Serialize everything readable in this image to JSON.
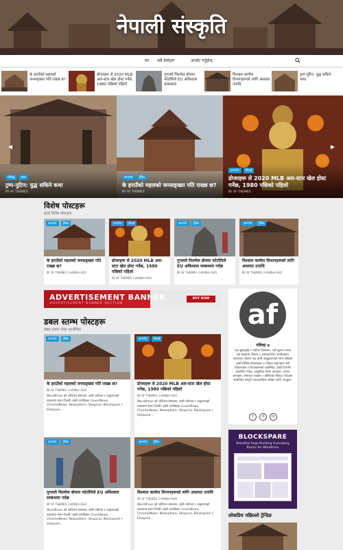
{
  "site": {
    "title": "नेपाली संस्कृति"
  },
  "nav": {
    "items": [
      "घर",
      "सबै डेमोहरू",
      "अपडेट गर्नुहोस्"
    ]
  },
  "colors": {
    "tag": "#1d9bd7",
    "ad_red": "#b5121b",
    "blockspare": "#3a1d56"
  },
  "ticker": [
    {
      "title": "के हराउँको महलको जनसङ्ख्या गति राख्छ छ?"
    },
    {
      "title": "डोजरहरू ले 2020 MLB अल-स्टार खेल होस्ट गर्नेछ, 1980 पछिको पहिलो"
    },
    {
      "title": "गुगलले फिल्मेल बोयमा फोटोमिले EU अविश्वास सम्बन्धमा"
    },
    {
      "title": "विश्वास कार्यमा विभागहरूको लागि असायत उपाधि"
    },
    {
      "title": "ट्रम्प-पुटिन: युद्ध सकिने कथा"
    }
  ],
  "slider": [
    {
      "tags": [
        "प्रसिद्ध",
        "यात्रा"
      ],
      "title": "ट्रम्प-पुटिन: युद्ध सकिने कथा",
      "meta": "BY AF THEMES"
    },
    {
      "tags": [
        "अन्तर्गत",
        "ट्रेंडिङ"
      ],
      "title": "के हराउँको महलको जनसङ्ख्या गति राख्छ छ?",
      "meta": "BY AF THEMES"
    },
    {
      "tags": [
        "अन्तर्गत",
        "फीचर्ड"
      ],
      "title": "डोजरहरू ले 2020 MLB अल-स्टार खेल होस्ट गर्नेछ, 1980 पछिको पहिलो",
      "meta": "BY AF THEMES"
    }
  ],
  "special": {
    "title": "विशेष पोस्टहरू",
    "subtitle": "हाम्रो विशेष पोस्टहरू",
    "posts": [
      {
        "tags": [
          "अन्तर्गत",
          "ट्रेंडिङ"
        ],
        "title": "के हराउँको महलको जनसङ्ख्या गति राख्छ छ?",
        "meta": "BY AF THEMES  3 वर्षपहिला AGO"
      },
      {
        "tags": [
          "अन्तर्गत",
          "फीचर्ड"
        ],
        "title": "डोजरहरू ले 2020 MLB अल-स्टार खेल होस्ट गर्नेछ, 1980 पछिको पहिलो",
        "meta": "BY AF THEMES  3 वर्षपहिला AGO"
      },
      {
        "tags": [
          "अन्तर्गत",
          "ट्रेंडिङ"
        ],
        "title": "गुगलले फिल्मेल बोयमा फोटोमिले EU अविश्वास सम्बन्धमा गर्दछ",
        "meta": "BY AF THEMES  3 वर्षपहिला AGO"
      },
      {
        "tags": [
          "अन्तर्गत",
          "ट्रेंडिङ"
        ],
        "title": "विश्वास कार्यमा विभागहरूको लागि असायत उपाधि",
        "meta": "BY AF THEMES  3 वर्षपहिला AGO"
      }
    ]
  },
  "ad": {
    "title": "ADVERTISEMENT BANNER",
    "subtitle": "ADVERTISEMENT BANNER SECTION",
    "button": "BUY NOW"
  },
  "double": {
    "title": "डबल स्तम्भ पोस्टहरू",
    "subtitle": "डबल स्तम्भ पोस्ट उपशीर्षक",
    "posts": [
      {
        "tags": [
          "अन्तर्गत",
          "ट्रेंडिङ"
        ],
        "title": "के हराउँको महलको जनसङ्ख्या गति राख्छ छ?",
        "meta": "BY AF THEMES  3 वर्षपहिला AGO",
        "excerpt": "WordPress को प्लेटिनम संसारमा, हामी नवीनता र उत्कृष्टताको प्रकाशमा स्थान दिन्छौ। हाम्रो उपाधिहरू CoverNews, ChromeNews, Newsphere, Shopical, Blockspare र Elespare..."
      },
      {
        "tags": [
          "अन्तर्गत",
          "फीचर्ड"
        ],
        "title": "डोजरहरू ले 2020 MLB अल-स्टार खेल होस्ट गर्नेछ, 1980 पछिको पहिलो",
        "meta": "BY AF THEMES  3 वर्षपहिला AGO",
        "excerpt": "WordPress को प्लेटिनम संसारमा, हामी नवीनता र उत्कृष्टताको प्रकाशमा स्थान दिन्छौ। हाम्रो उपाधिहरू CoverNews, ChromeNews, Newsphere, Shopical, Blockspare र Elespare..."
      },
      {
        "tags": [
          "अन्तर्गत",
          "ट्रेंडिङ"
        ],
        "title": "गुगलले फिल्मेल बोयमा फोटोमिले EU अविश्वास सम्बन्धमा गर्दछ",
        "meta": "BY AF THEMES  3 वर्षपहिला AGO",
        "excerpt": "WordPress को प्लेटिनम संसारमा, हामी नवीनता र उत्कृष्टताको प्रकाशमा स्थान दिन्छौ। हाम्रो उपाधिहरू CoverNews, ChromeNews, Newsphere, Shopical, Blockspare र Elespare..."
      },
      {
        "tags": [
          "अन्तर्गत",
          "ट्रेंडिङ"
        ],
        "title": "विश्वास कार्यमा विभागहरूको लागि असायत उपाधि",
        "meta": "BY AF THEMES  3 वर्षपहिला AGO",
        "excerpt": "WordPress को प्लेटिनम संसारमा, हामी नवीनता र उत्कृष्टताको प्रकाशमा स्थान दिन्छौ। हाम्रो उपाधिहरू CoverNews, ChromeNews, Newsphere, Shopical, Blockspare र Elespare..."
      }
    ]
  },
  "profile": {
    "logo": "af",
    "name": "पत्रिका ७",
    "desc": "एक सुसाइडेड र नयाँपन विषयमा, नयाँ सुरुमा रुपमा यस बखतमा पोस्टरू र समयकल्पित अपडेटहरू। समयावर प्लेटमा एक हामी अनुकूलताको साथ पछिको हामी विभिन्न सेक्शनहरू र पत्रिका कहानहरू सबै विकल्पहरू र विचारहरूको व्यवस्थित, हाम्रो टिप्पणि प्रकाशित गर्दछ। आधुनिक फेसन ब्लगहरू, ट्राभल ब्लगहरू, समाचार पत्रहरू र कोरिएका विस्तृत प्लेटहरू सम्बन्धित सम्पूर्ण जानकारीहरू सबैका लागि उपयुक्त।",
    "social": [
      "f",
      "X",
      "in"
    ]
  },
  "blockspare": {
    "name": "BLOCKSPARE",
    "tagline": "Beautiful Page Building Gutenberg Blocks for WordPress"
  },
  "trending": {
    "title": "लोकप्रिय पछिल्लो ट्रेन्डिङ"
  }
}
